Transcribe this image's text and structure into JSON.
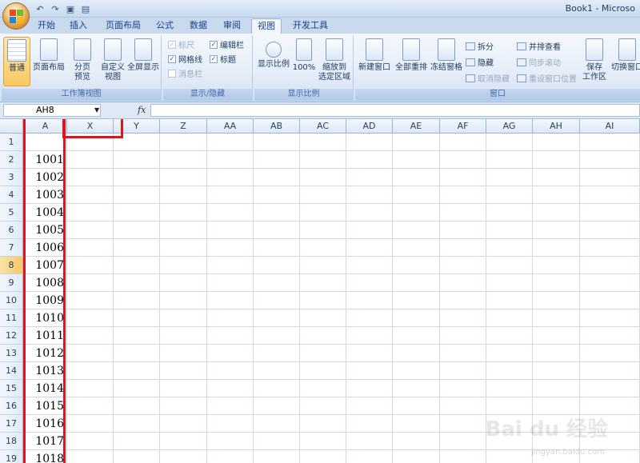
{
  "window": {
    "title": "Book1 - Microso"
  },
  "qat": [
    {
      "icon": "undo-icon",
      "glyph": "↶"
    },
    {
      "icon": "redo-icon",
      "glyph": "↷"
    },
    {
      "icon": "save-icon",
      "glyph": "▣"
    },
    {
      "icon": "print-preview-icon",
      "glyph": "▤"
    }
  ],
  "tabs": [
    "开始",
    "插入",
    "页面布局",
    "公式",
    "数据",
    "审阅",
    "视图",
    "开发工具"
  ],
  "active_tab": "视图",
  "ribbon": {
    "workbook_views": {
      "label": "工作簿视图",
      "normal": "普通",
      "page_layout": "页面布局",
      "page_break": "分页\n预览",
      "custom_views": "自定义\n视图",
      "full_screen": "全屏显示"
    },
    "show_hide": {
      "label": "显示/隐藏",
      "ruler": {
        "text": "标尺",
        "checked": true,
        "enabled": false
      },
      "gridlines": {
        "text": "网格线",
        "checked": true,
        "enabled": true
      },
      "message_bar": {
        "text": "消息栏",
        "checked": false,
        "enabled": false
      },
      "formula_bar": {
        "text": "编辑栏",
        "checked": true,
        "enabled": true
      },
      "headings": {
        "text": "标题",
        "checked": true,
        "enabled": true
      }
    },
    "zoom": {
      "label": "显示比例",
      "zoom": "显示比例",
      "hundred": "100%",
      "zoom_selection": "缩放到\n选定区域"
    },
    "window": {
      "label": "窗口",
      "new_window": "新建窗口",
      "arrange_all": "全部重排",
      "freeze_panes": "冻结窗格",
      "split": "拆分",
      "hide": "隐藏",
      "unhide": "取消隐藏",
      "side_by_side": "并排查看",
      "sync_scroll": "同步滚动",
      "reset_position": "重设窗口位置",
      "save_workspace": "保存\n工作区",
      "switch_windows": "切换窗口"
    }
  },
  "formula_bar": {
    "name_box": "AH8",
    "fx": "fx",
    "value": ""
  },
  "columns": [
    "A",
    "X",
    "Y",
    "Z",
    "AA",
    "AB",
    "AC",
    "AD",
    "AE",
    "AF",
    "AG",
    "AH",
    "AI"
  ],
  "rows": [
    "1",
    "2",
    "3",
    "4",
    "5",
    "6",
    "7",
    "8",
    "9",
    "10",
    "11",
    "12",
    "13",
    "14",
    "15",
    "16",
    "17",
    "18",
    "19"
  ],
  "selected_row": "8",
  "column_a_values": [
    "",
    "1001",
    "1002",
    "1003",
    "1004",
    "1005",
    "1006",
    "1007",
    "1008",
    "1009",
    "1010",
    "1011",
    "1012",
    "1013",
    "1014",
    "1015",
    "1016",
    "1017",
    "1018"
  ],
  "watermark": {
    "brand": "Bai du 经验",
    "url": "jingyan.baidu.com"
  }
}
